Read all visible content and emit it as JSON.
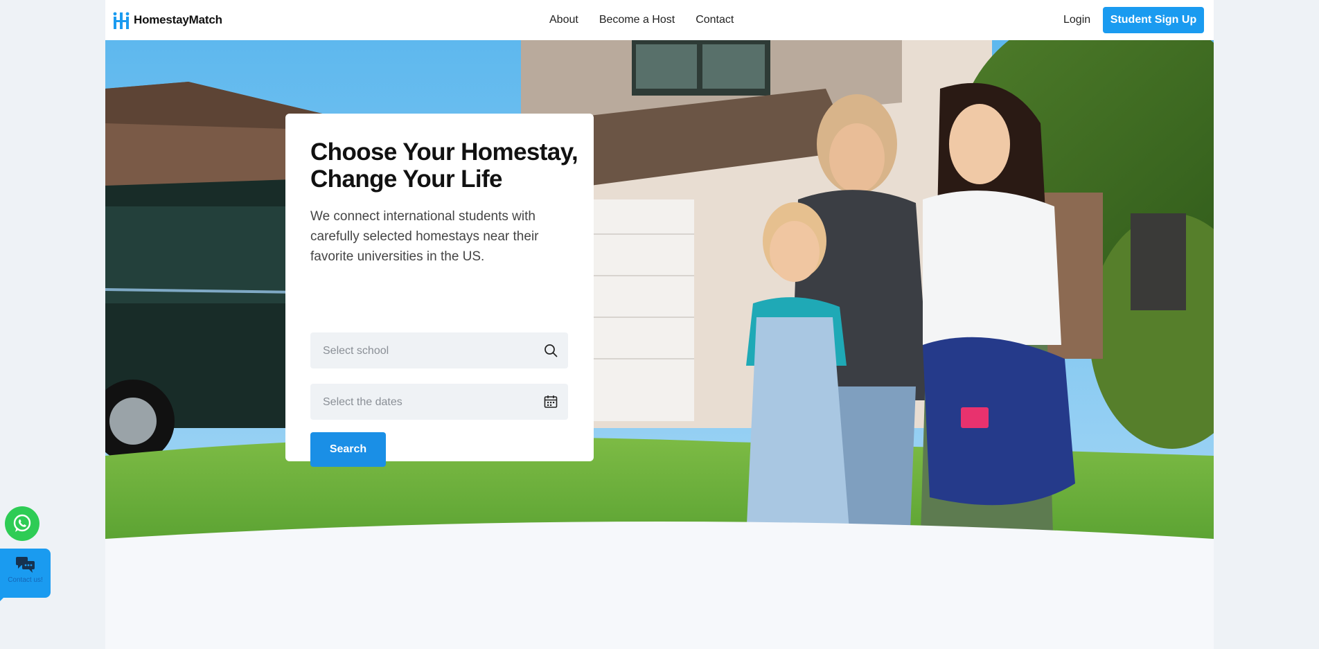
{
  "brand": {
    "name": "HomestayMatch",
    "accent": "#1a9bf0"
  },
  "nav": {
    "items": [
      "About",
      "Become a Host",
      "Contact"
    ]
  },
  "header": {
    "login_label": "Login",
    "signup_label": "Student Sign Up"
  },
  "hero": {
    "title_line1": "Choose Your Homestay,",
    "title_line2": "Change Your Life",
    "description": "We connect international students with carefully selected homestays near their favorite universities in the US.",
    "school_placeholder": "Select school",
    "dates_placeholder": "Select the dates",
    "search_label": "Search",
    "school_icon": "search-icon",
    "dates_icon": "calendar-icon"
  },
  "widgets": {
    "whatsapp_icon": "whatsapp-icon",
    "contact_label": "Contact us!",
    "contact_icon": "chat-bubbles-icon"
  }
}
